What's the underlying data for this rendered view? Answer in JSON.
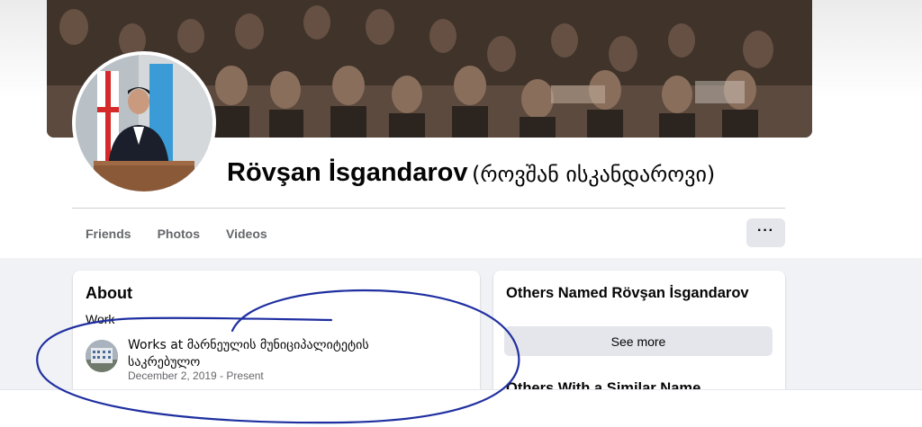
{
  "profile": {
    "name": "Rövşan İsgandarov",
    "alternate_name": "(როვშან ისკანდაროვი)"
  },
  "tabs": [
    {
      "label": "Friends"
    },
    {
      "label": "Photos"
    },
    {
      "label": "Videos"
    }
  ],
  "more_button": {
    "label": "···",
    "icon": "more-horizontal-icon"
  },
  "about": {
    "title": "About",
    "section_label": "Work",
    "work_text": "Works at მარნეულის მუნიციპალიტეტის საკრებულო",
    "work_dates": "December 2, 2019 - Present"
  },
  "others": {
    "title": "Others Named Rövşan İsgandarov",
    "see_more_label": "See more",
    "similar_title": "Others With a Similar Name"
  },
  "colors": {
    "annotation": "#1f2fa0",
    "secondary_text": "#65676b",
    "button_bg": "#e4e6eb",
    "page_bg": "#f0f2f5"
  }
}
